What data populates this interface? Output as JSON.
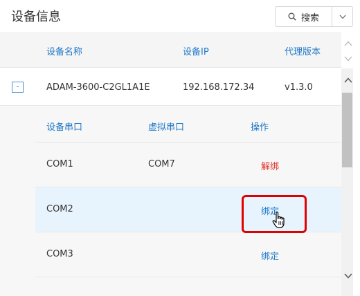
{
  "header": {
    "title": "设备信息",
    "search_label": "搜索",
    "search_icon": "search-icon",
    "dropdown_icon": "chevron-down-icon"
  },
  "table": {
    "columns": [
      "设备名称",
      "设备IP",
      "代理版本"
    ],
    "rows": [
      {
        "expand_symbol": "-",
        "device_name": "ADAM-3600-C2GL1A1E",
        "device_ip": "192.168.172.34",
        "agent_version": "v1.3.0"
      }
    ]
  },
  "sub_table": {
    "columns": [
      "设备串口",
      "虚拟串口",
      "操作"
    ],
    "rows": [
      {
        "serial": "COM1",
        "virtual": "COM7",
        "action": "解绑"
      },
      {
        "serial": "COM2",
        "virtual": "",
        "action": "绑定"
      },
      {
        "serial": "COM3",
        "virtual": "",
        "action": "绑定"
      }
    ]
  },
  "colors": {
    "header_link": "#1f78c8",
    "unbind": "#e0322b",
    "bind": "#1f78c8",
    "highlight": "#e00000",
    "row_hover": "#e8f4fd"
  }
}
